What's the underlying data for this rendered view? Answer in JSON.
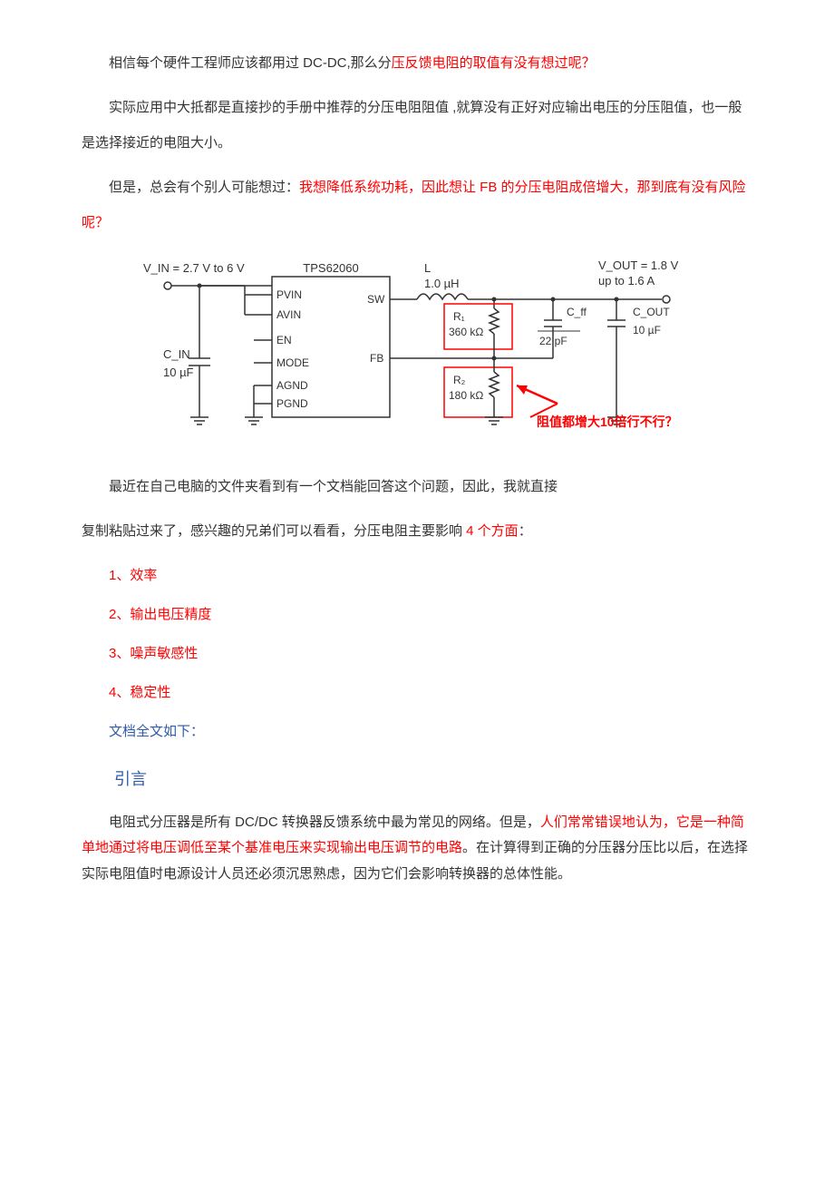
{
  "p1": {
    "a": "相信每个硬件工程师应该都用过 DC-DC,那么分",
    "b": "压反馈电阻的取值有没有想过呢？"
  },
  "p2": "实际应用中大抵都是直接抄的手册中推荐的分压电阻阻值 ,就算没有正好对应输出电压的分压阻值，也一般是选择接近的电阻大小。",
  "p3": {
    "a": "但是，总会有个别人可能想过：",
    "b": "我想降低系统功耗，因此想让 FB 的分压电阻成倍增大，那到底有没有风险呢？"
  },
  "circuit": {
    "vin": "V_IN = 2.7 V to 6 V",
    "chip": "TPS62060",
    "pins": {
      "pvin": "PVIN",
      "avin": "AVIN",
      "en": "EN",
      "mode": "MODE",
      "agnd": "AGND",
      "pgnd": "PGND",
      "sw": "SW",
      "fb": "FB"
    },
    "cin_label": "C_IN",
    "cin_val": "10 µF",
    "L_label": "L",
    "L_val": "1.0 µH",
    "R1_label": "R₁",
    "R1_val": "360 kΩ",
    "R2_label": "R₂",
    "R2_val": "180 kΩ",
    "Cff_label": "C_ff",
    "Cff_val": "22 pF",
    "Cout_label": "C_OUT",
    "Cout_val": "10 µF",
    "Vout_label": "V_OUT = 1.8 V",
    "Vout_sub": "up to 1.6 A",
    "annotation": "阻值都增大10倍行不行？"
  },
  "p4": "最近在自己电脑的文件夹看到有一个文档能回答这个问题，因此，我就直接",
  "p5": {
    "a": "复制粘贴过来了，感兴趣的兄弟们可以看看，分压电阻主要影响 ",
    "b": "4 个方面",
    "c": "："
  },
  "list": {
    "i1": "1、效率",
    "i2": "2、输出电压精度",
    "i3": "3、噪声敏感性",
    "i4": "4、稳定性"
  },
  "doc_full": "文档全文如下：",
  "intro": "引言",
  "p6": {
    "a": "电阻式分压器是所有 DC/DC 转换器反馈系统中最为常见的网络。但是，",
    "b": "人们常常错误地认为，它是一种简单地通过将电压调低至某个基准电压来实现输出电压调节的电路",
    "c": "。在计算得到正确的分压器分压比以后，在选择实际电阻值时电源设计人员还必须沉思熟虑，因为它们会影响转换器的总体性能。"
  }
}
